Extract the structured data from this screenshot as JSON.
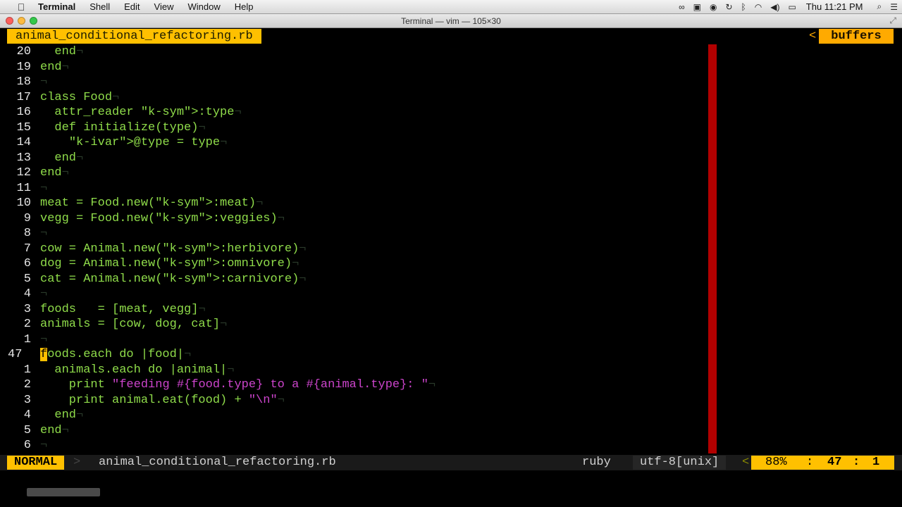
{
  "menubar": {
    "apple": "",
    "app": "Terminal",
    "items": [
      "Shell",
      "Edit",
      "View",
      "Window",
      "Help"
    ],
    "clock": "Thu 11:21 PM"
  },
  "window": {
    "title": "Terminal — vim — 105×30"
  },
  "vim": {
    "tab_filename": "animal_conditional_refactoring.rb",
    "buffers_sep": "<",
    "buffers_label": "buffers",
    "lines": [
      {
        "num": "20",
        "code": "  end"
      },
      {
        "num": "19",
        "code": "end"
      },
      {
        "num": "18",
        "code": ""
      },
      {
        "num": "17",
        "code": "class Food"
      },
      {
        "num": "16",
        "code": "  attr_reader :type"
      },
      {
        "num": "15",
        "code": "  def initialize(type)"
      },
      {
        "num": "14",
        "code": "    @type = type"
      },
      {
        "num": "13",
        "code": "  end"
      },
      {
        "num": "12",
        "code": "end"
      },
      {
        "num": "11",
        "code": ""
      },
      {
        "num": "10",
        "code": "meat = Food.new(:meat)"
      },
      {
        "num": "9",
        "code": "vegg = Food.new(:veggies)"
      },
      {
        "num": "8",
        "code": ""
      },
      {
        "num": "7",
        "code": "cow = Animal.new(:herbivore)"
      },
      {
        "num": "6",
        "code": "dog = Animal.new(:omnivore)"
      },
      {
        "num": "5",
        "code": "cat = Animal.new(:carnivore)"
      },
      {
        "num": "4",
        "code": ""
      },
      {
        "num": "3",
        "code": "foods   = [meat, vegg]"
      },
      {
        "num": "2",
        "code": "animals = [cow, dog, cat]"
      },
      {
        "num": "1",
        "code": ""
      },
      {
        "num": "47",
        "code": "foods.each do |food|"
      },
      {
        "num": "1",
        "code": "  animals.each do |animal|"
      },
      {
        "num": "2",
        "code": "    print \"feeding #{food.type} to a #{animal.type}: \""
      },
      {
        "num": "3",
        "code": "    print animal.eat(food) + \"\\n\""
      },
      {
        "num": "4",
        "code": "  end"
      },
      {
        "num": "5",
        "code": "end"
      },
      {
        "num": "6",
        "code": ""
      }
    ],
    "eol_marker": "¬",
    "status": {
      "mode": "NORMAL",
      "mode_sep": ">",
      "filename": "animal_conditional_refactoring.rb",
      "filetype": "ruby",
      "encoding": "utf-8[unix]",
      "enc_sep": "<",
      "percent": "88%",
      "pos_sep": ":",
      "line": "47",
      "colon": ":",
      "col": "1"
    }
  },
  "colors": {
    "tab_active": "#ffc000",
    "buffers": "#ffaa00",
    "code_green": "#8fdc4a",
    "symbol_magenta": "#cc44cc",
    "ivar_cyan": "#6ed8f5",
    "colorcolumn": "#b20000"
  }
}
